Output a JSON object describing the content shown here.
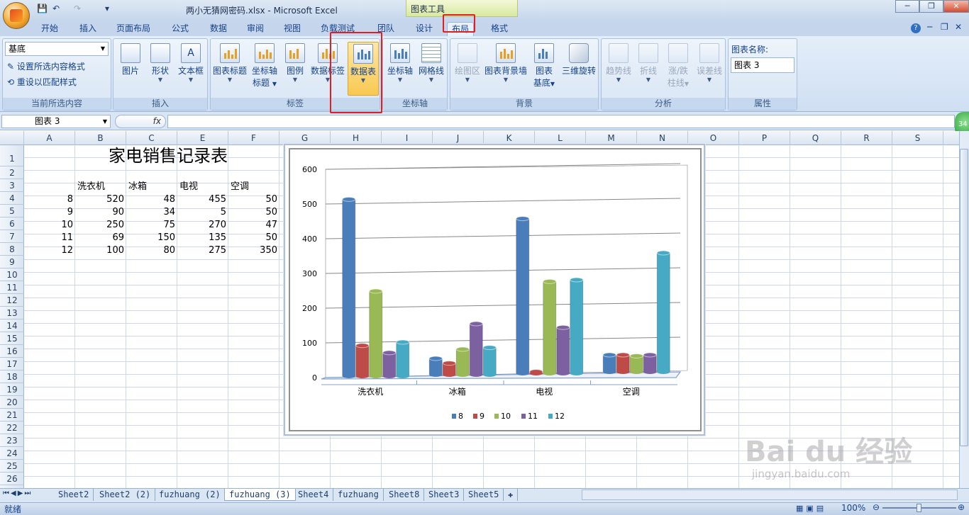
{
  "window": {
    "title": "两小无猜网密码.xlsx - Microsoft Excel",
    "context_group": "图表工具"
  },
  "qat": {
    "save": "💾",
    "undo": "↶",
    "redo": "↷",
    "more": "▾"
  },
  "tabs": [
    "开始",
    "插入",
    "页面布局",
    "公式",
    "数据",
    "审阅",
    "视图",
    "负载测试",
    "团队",
    "设计",
    "布局",
    "格式"
  ],
  "active_tab": "布局",
  "ribbon": {
    "current_selection": {
      "dropdown_value": "基底",
      "format_selection": "设置所选内容格式",
      "reset_style": "重设以匹配样式",
      "label": "当前所选内容"
    },
    "insert": {
      "picture": "图片",
      "shapes": "形状",
      "textbox": "文本框",
      "label": "插入"
    },
    "labels": {
      "chart_title": "图表标题",
      "axis_titles_1": "坐标轴",
      "axis_titles_2": "标题",
      "legend": "图例",
      "data_labels": "数据标签",
      "data_table": "数据表",
      "label": "标签"
    },
    "axes": {
      "axes": "坐标轴",
      "gridlines": "网格线",
      "label": "坐标轴"
    },
    "background": {
      "plot_area": "绘图区",
      "chart_wall": "图表背景墙",
      "chart_floor_1": "图表",
      "chart_floor_2": "基底",
      "rotation": "三维旋转",
      "label": "背景"
    },
    "analysis": {
      "trendline": "趋势线",
      "lines": "折线",
      "updown_1": "涨/跌",
      "updown_2": "柱线",
      "error_bars": "误差线",
      "label": "分析"
    },
    "properties": {
      "chart_name_label": "图表名称:",
      "chart_name": "图表 3",
      "label": "属性"
    }
  },
  "formula_bar": {
    "name_box": "图表 3",
    "fx": "fx"
  },
  "columns": [
    "A",
    "B",
    "C",
    "E",
    "F",
    "G",
    "H",
    "I",
    "J",
    "K",
    "L",
    "M",
    "N",
    "O",
    "P",
    "Q",
    "R",
    "S"
  ],
  "rows": [
    "1",
    "2",
    "3",
    "4",
    "5",
    "6",
    "7",
    "8",
    "9",
    "10",
    "11",
    "12",
    "13",
    "14",
    "15",
    "16",
    "17",
    "18",
    "19",
    "20",
    "21",
    "22",
    "23",
    "24",
    "25",
    "26"
  ],
  "sheet": {
    "title": "家电销售记录表",
    "headers": [
      "洗衣机",
      "冰箱",
      "电视",
      "空调"
    ],
    "data": [
      [
        "8",
        "520",
        "48",
        "455",
        "50"
      ],
      [
        "9",
        "90",
        "34",
        "5",
        "50"
      ],
      [
        "10",
        "250",
        "75",
        "270",
        "47"
      ],
      [
        "11",
        "69",
        "150",
        "135",
        "50"
      ],
      [
        "12",
        "100",
        "80",
        "275",
        "350"
      ]
    ]
  },
  "chart_data": {
    "type": "bar",
    "categories": [
      "洗衣机",
      "冰箱",
      "电视",
      "空调"
    ],
    "series": [
      {
        "name": "8",
        "values": [
          520,
          48,
          455,
          50
        ],
        "color": "#4a7ebb"
      },
      {
        "name": "9",
        "values": [
          90,
          34,
          5,
          50
        ],
        "color": "#be4b48"
      },
      {
        "name": "10",
        "values": [
          250,
          75,
          270,
          47
        ],
        "color": "#98b954"
      },
      {
        "name": "11",
        "values": [
          69,
          150,
          135,
          50
        ],
        "color": "#7d60a0"
      },
      {
        "name": "12",
        "values": [
          100,
          80,
          275,
          350
        ],
        "color": "#46aac5"
      }
    ],
    "yticks": [
      "0",
      "100",
      "200",
      "300",
      "400",
      "500",
      "600"
    ],
    "ylim": [
      0,
      600
    ],
    "legend": "bottom",
    "grid": true
  },
  "sheet_tabs": [
    "Sheet2",
    "Sheet2 (2)",
    "fuzhuang (2)",
    "fuzhuang (3)",
    "Sheet4",
    "fuzhuang",
    "Sheet8",
    "Sheet3",
    "Sheet5"
  ],
  "active_sheet": "fuzhuang (3)",
  "status": {
    "ready": "就绪",
    "zoom": "100%"
  },
  "watermark": {
    "brand": "Bai du 经验",
    "url": "jingyan.baidu.com"
  },
  "badge": "34"
}
